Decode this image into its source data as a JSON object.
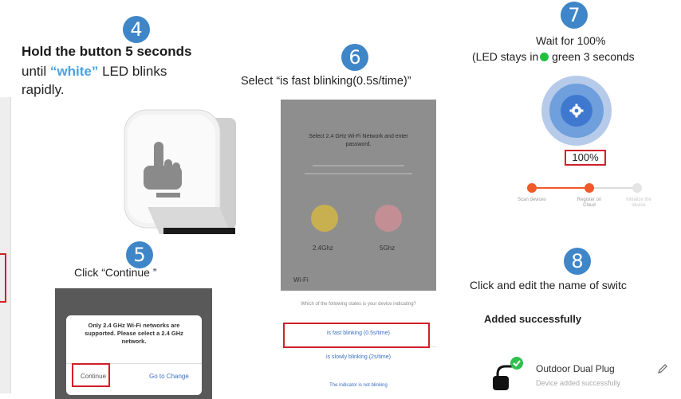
{
  "step4": {
    "number": "4",
    "bold_line": "Hold the button 5 seconds",
    "line2_prefix": "until ",
    "line2_highlight": "“white”",
    "line2_suffix": " LED blinks",
    "line3": "rapidly.",
    "highlight_color": "#4aa3df"
  },
  "step5": {
    "number": "5",
    "caption": "Click “Continue ”",
    "dialog": {
      "message": "Only 2.4 GHz Wi-Fi networks are supported. Please select a 2.4 GHz network.",
      "continue_label": "Continue",
      "go_to_change_label": "Go to Change"
    }
  },
  "step6": {
    "number": "6",
    "caption": "Select “is fast blinking(0.5s/time)”",
    "screen": {
      "top_text": "Select 2.4 GHz Wi-Fi Network and enter password.",
      "band_24": "2.4Ghz",
      "band_5": "5Ghz",
      "wifi_label": "Wi-Fi",
      "sheet_question": "Which of the following states is your device indicating?",
      "fast_option": "is fast blinking (0.5s/time)",
      "slow_option": "is slowly blinking (2s/time)",
      "footer_link": "The indicator is not blinking"
    }
  },
  "step7": {
    "number": "7",
    "line1": "Wait for 100%",
    "line2_prefix": "(LED stays in",
    "line2_suffix": " green 3 seconds",
    "led_color": "#1fbf3f",
    "percent": "100%",
    "progress_steps": [
      "Scan devices",
      "Register on Cloud",
      "Initialize the device"
    ]
  },
  "step8": {
    "number": "8",
    "caption": "Click and edit the name of switc",
    "heading": "Added successfully",
    "device_name": "Outdoor Dual Plug",
    "device_status": "Device added successfully"
  },
  "colors": {
    "step_circle": "#3f86c8",
    "red_outline": "#d0202b",
    "accent_orange": "#f05a28"
  }
}
